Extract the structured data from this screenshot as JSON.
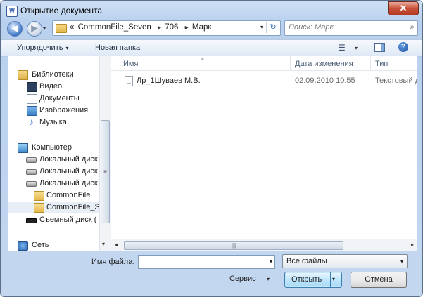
{
  "window": {
    "title": "Открытие документа",
    "app_icon_letter": "W",
    "close_glyph": "✕"
  },
  "nav": {
    "back_glyph": "◀",
    "forward_glyph": "▶",
    "dropdown_glyph": "▾"
  },
  "address": {
    "overflow_glyph": "«",
    "crumbs": [
      "CommonFile_Seven",
      "706",
      "Марк"
    ],
    "separator": "▸",
    "dropdown_glyph": "▾",
    "refresh_glyph": "↻",
    "folder_icon": "folder-icon"
  },
  "search": {
    "placeholder": "Поиск: Марк",
    "icon_glyph": "⌕"
  },
  "toolbar": {
    "organize_label": "Упорядочить",
    "new_folder_label": "Новая папка",
    "caret": "▾",
    "views_glyph": "☰",
    "help_glyph": "?"
  },
  "sidebar": {
    "items": [
      {
        "label": "Библиотеки",
        "icon": "libraries-icon"
      },
      {
        "label": "Видео",
        "icon": "video-icon"
      },
      {
        "label": "Документы",
        "icon": "documents-icon"
      },
      {
        "label": "Изображения",
        "icon": "images-icon"
      },
      {
        "label": "Музыка",
        "icon": "music-icon",
        "glyph": "♪"
      },
      {
        "label": "Компьютер",
        "icon": "computer-icon"
      },
      {
        "label": "Локальный диск",
        "icon": "disk-icon"
      },
      {
        "label": "Локальный диск",
        "icon": "disk-icon"
      },
      {
        "label": "Локальный диск",
        "icon": "disk-icon"
      },
      {
        "label": "CommonFile",
        "icon": "folder-icon"
      },
      {
        "label": "CommonFile_S",
        "icon": "folder-icon",
        "selected": true
      },
      {
        "label": "Съемный диск (",
        "icon": "removable-disk-icon"
      },
      {
        "label": "Сеть",
        "icon": "network-icon"
      }
    ],
    "scroll_down_glyph": "▾",
    "scroll_grip": "≡"
  },
  "file_list": {
    "columns": [
      "Имя",
      "Дата изменения",
      "Тип"
    ],
    "sort_glyph": "▴",
    "rows": [
      {
        "name": "Лр_1Шуваев М.В.",
        "date": "02.09.2010 10:55",
        "type": "Текстовый д",
        "icon": "text-file-icon"
      }
    ]
  },
  "hscroll": {
    "left_glyph": "◂",
    "right_glyph": "▸",
    "grip": "|||"
  },
  "footer": {
    "filename_label_accel": "И",
    "filename_label_rest": "мя файла:",
    "filename_value": "",
    "filename_dropdown_glyph": "▾",
    "filetype_selected": "Все файлы",
    "filetype_dropdown_glyph": "▾",
    "service_label": "Сервис",
    "service_caret": "▾",
    "open_label": "Открыть",
    "open_caret": "▾",
    "cancel_label": "Отмена"
  }
}
